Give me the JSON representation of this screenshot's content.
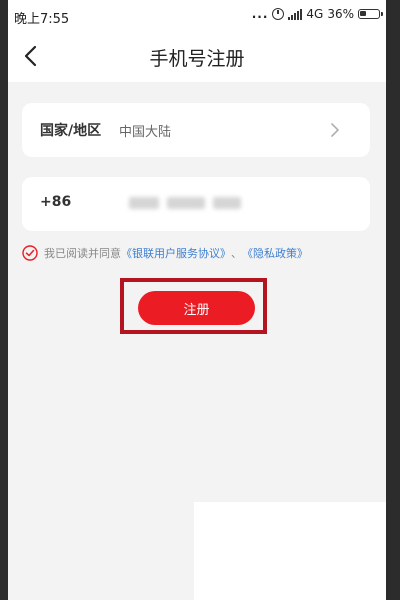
{
  "status_bar": {
    "time": "晚上7:55",
    "dots": "...",
    "network": "4G",
    "battery": "36%"
  },
  "nav": {
    "title": "手机号注册"
  },
  "country": {
    "label": "国家/地区",
    "value": "中国大陆"
  },
  "phone": {
    "prefix": "+86"
  },
  "agreement": {
    "prefix": "我已阅读并同意",
    "terms_link": "《银联用户服务协议》",
    "separator": "、",
    "privacy_link": "《隐私政策》"
  },
  "register": {
    "label": "注册"
  },
  "colors": {
    "accent_red": "#ec1c24",
    "highlight_outline": "#b41320",
    "link_blue": "#3f7fcf",
    "background": "#f3f3f3"
  },
  "icons": {
    "back": "chevron-left-icon",
    "forward": "chevron-right-icon",
    "check": "check-circle-icon",
    "alarm": "alarm-icon",
    "signal": "signal-icon",
    "battery": "battery-icon"
  }
}
